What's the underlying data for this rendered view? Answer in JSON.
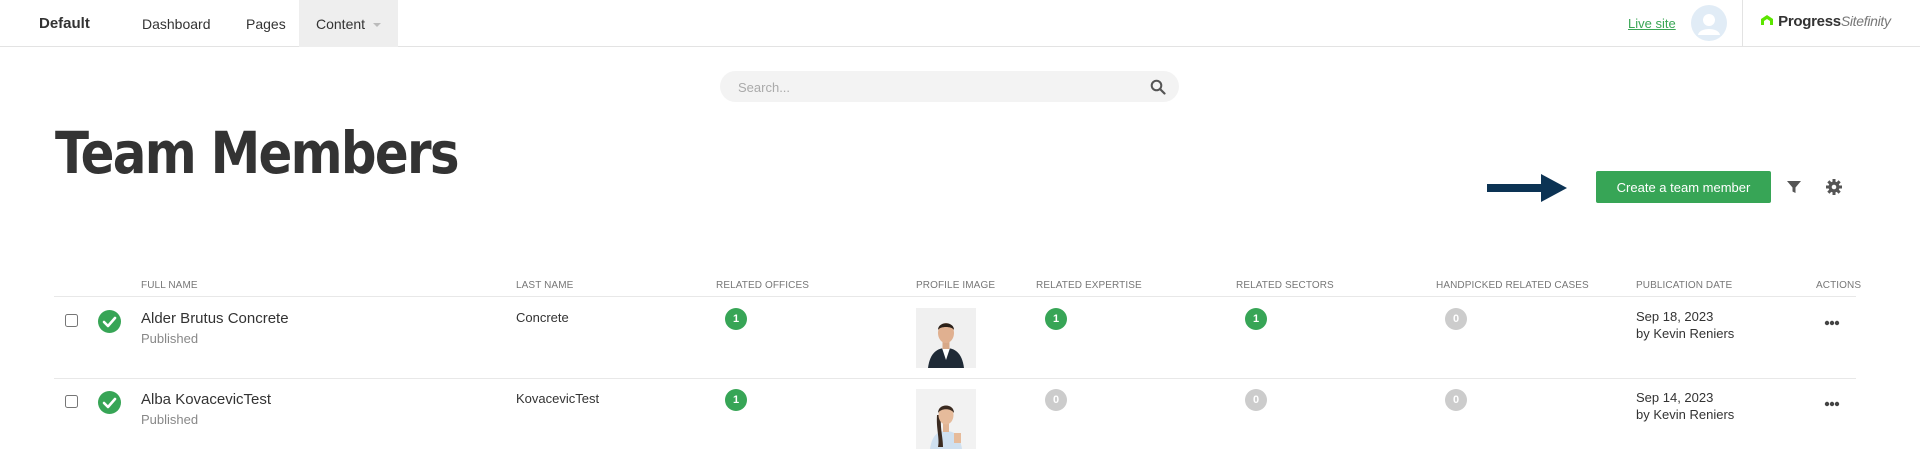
{
  "header": {
    "site_name": "Default",
    "nav": [
      "Dashboard",
      "Pages",
      "Content"
    ],
    "live_site": "Live site",
    "logo": {
      "brand": "Progress",
      "product": "Sitefinity"
    }
  },
  "search": {
    "placeholder": "Search..."
  },
  "page": {
    "title": "Team Members",
    "create_button": "Create a team member"
  },
  "table": {
    "columns": [
      "FULL NAME",
      "LAST NAME",
      "RELATED OFFICES",
      "PROFILE IMAGE",
      "RELATED EXPERTISE",
      "RELATED SECTORS",
      "HANDPICKED RELATED CASES",
      "PUBLICATION DATE",
      "ACTIONS"
    ],
    "rows": [
      {
        "full_name": "Alder Brutus Concrete",
        "status": "Published",
        "last_name": "Concrete",
        "related_offices": "1",
        "related_expertise": "1",
        "related_sectors": "1",
        "handpicked_cases": "0",
        "date": "Sep 18, 2023",
        "author": "by Kevin Reniers"
      },
      {
        "full_name": "Alba KovacevicTest",
        "status": "Published",
        "last_name": "KovacevicTest",
        "related_offices": "1",
        "related_expertise": "0",
        "related_sectors": "0",
        "handpicked_cases": "0",
        "date": "Sep 14, 2023",
        "author": "by Kevin Reniers"
      }
    ]
  },
  "colors": {
    "accent": "#37a556",
    "arrow": "#0c3354",
    "badge_zero": "#cccccc"
  }
}
